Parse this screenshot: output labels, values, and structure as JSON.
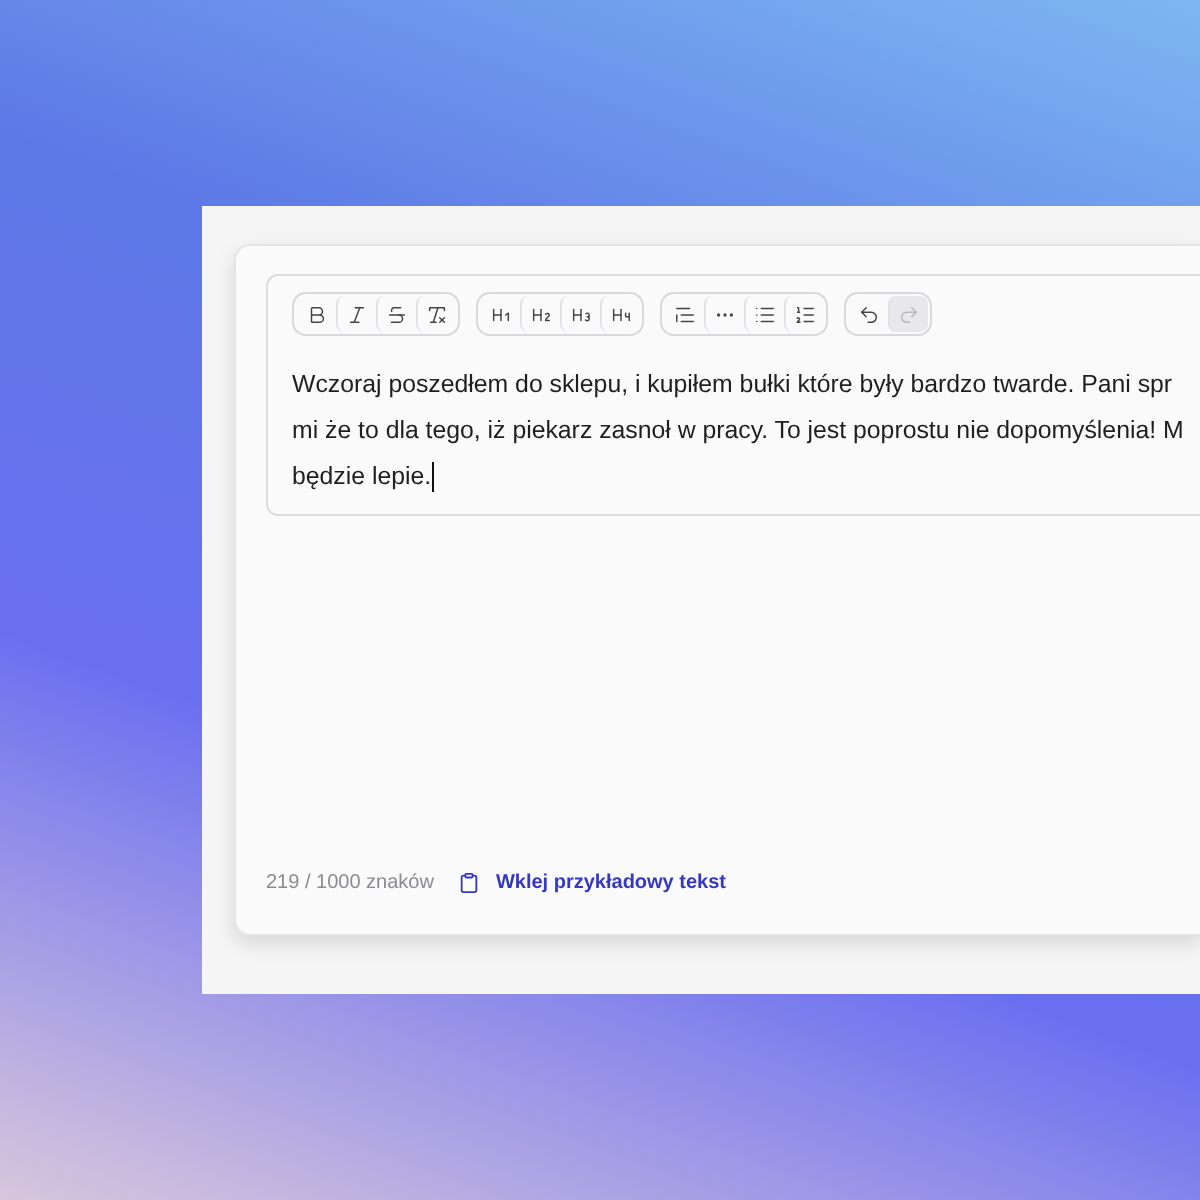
{
  "toolbar": {
    "groups": [
      [
        {
          "kind": "bold",
          "disabled": false
        },
        {
          "kind": "italic",
          "disabled": false
        },
        {
          "kind": "strike",
          "disabled": false
        },
        {
          "kind": "clear",
          "disabled": false
        }
      ],
      [
        {
          "kind": "h1",
          "disabled": false
        },
        {
          "kind": "h2",
          "disabled": false
        },
        {
          "kind": "h3",
          "disabled": false
        },
        {
          "kind": "h4",
          "disabled": false
        }
      ],
      [
        {
          "kind": "quote",
          "disabled": false
        },
        {
          "kind": "rule",
          "disabled": false
        },
        {
          "kind": "bullets",
          "disabled": false
        },
        {
          "kind": "numbers",
          "disabled": false
        }
      ],
      [
        {
          "kind": "undo",
          "disabled": false
        },
        {
          "kind": "redo",
          "disabled": true
        }
      ]
    ]
  },
  "editor": {
    "lines": [
      "Wczoraj poszedłem do sklepu, i kupiłem bułki które były bardzo twarde. Pani spr",
      "mi że to dla tego, iż piekarz zasnoł w pracy. To jest poprostu nie dopomyślenia! M",
      "będzie lepie."
    ]
  },
  "footer": {
    "counter": "219 / 1000 znaków",
    "paste_link": "Wklej przykładowy tekst"
  }
}
